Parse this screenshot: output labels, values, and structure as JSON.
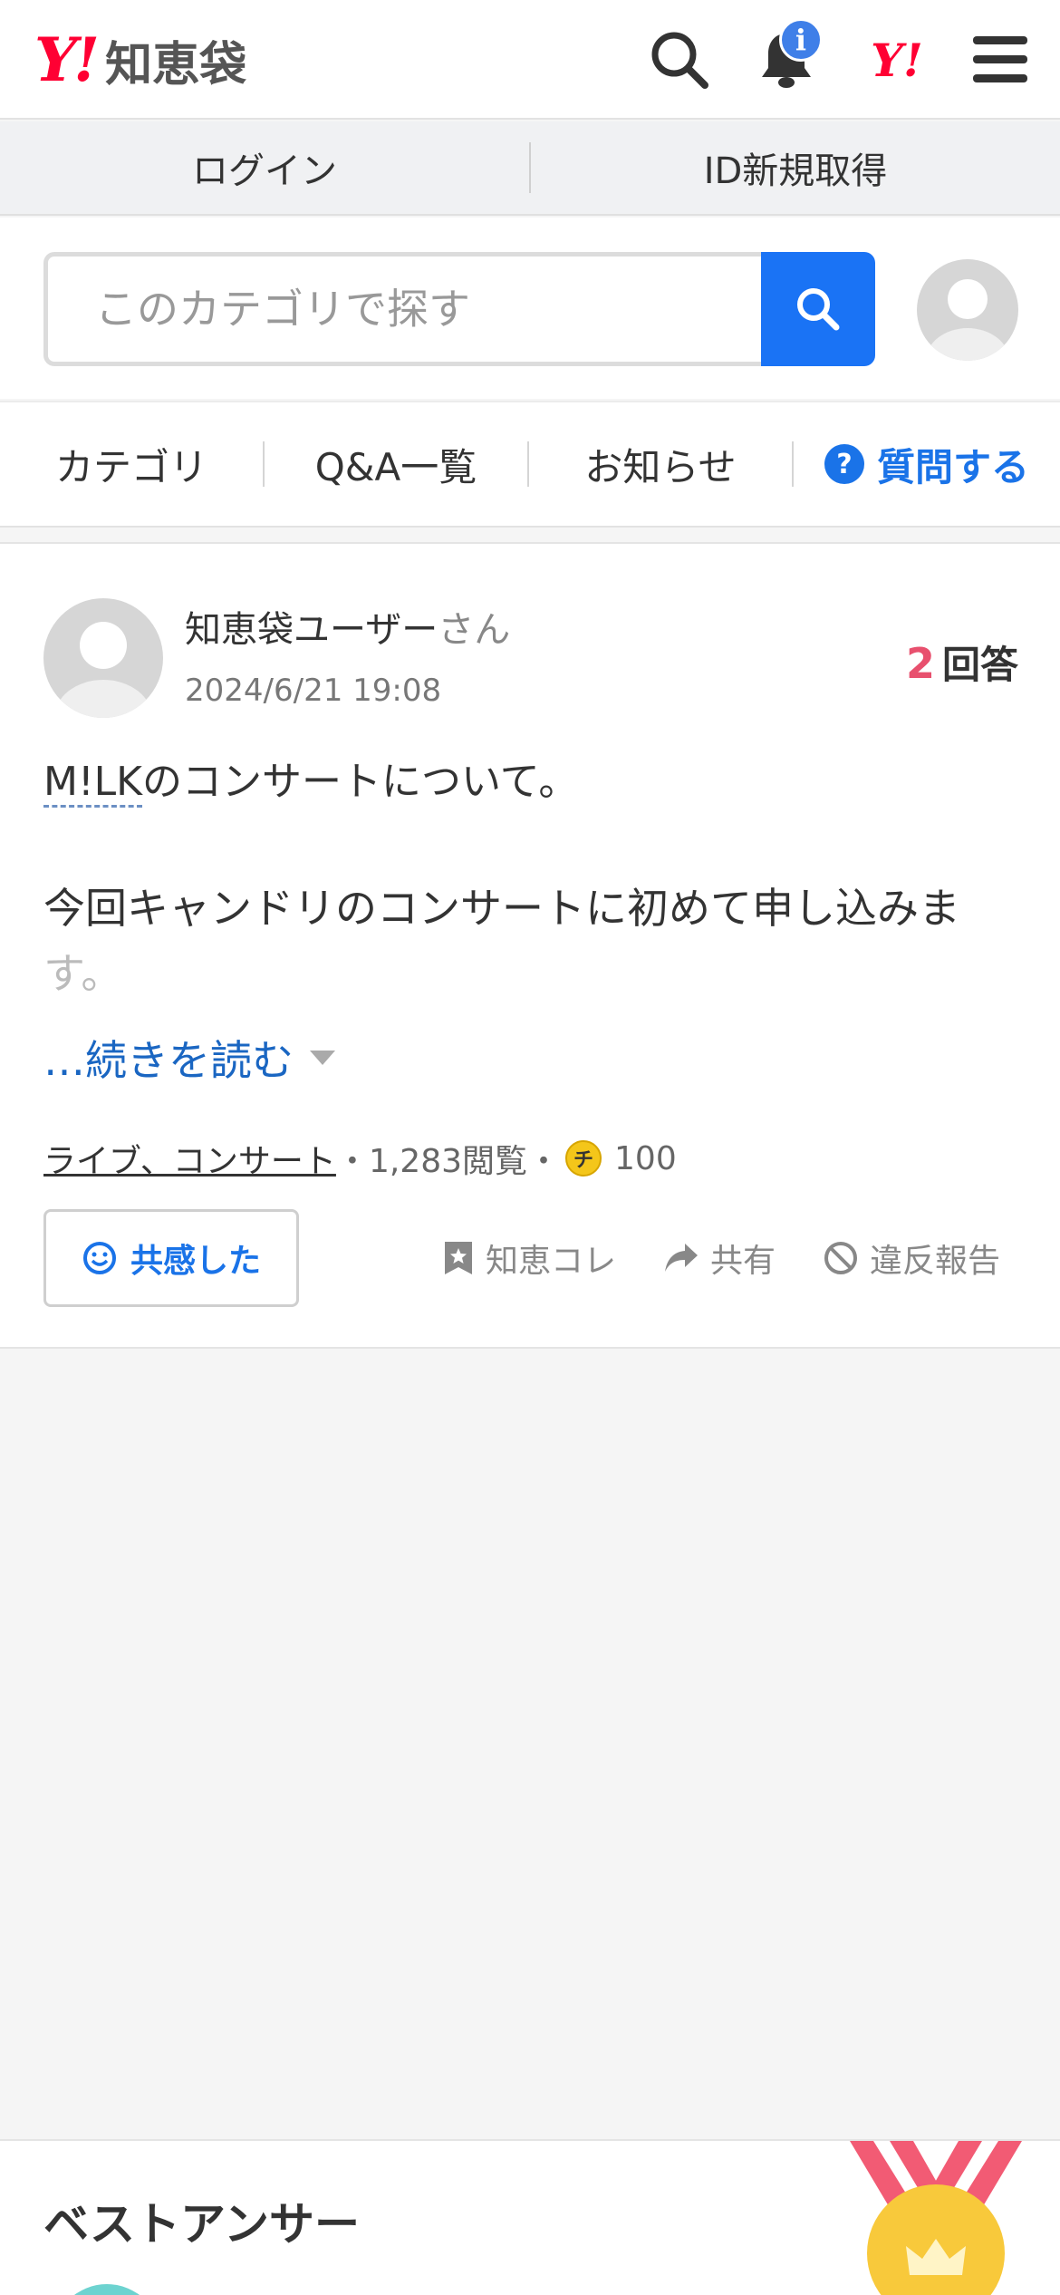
{
  "header": {
    "logo_y": "Y!",
    "logo_text": "知恵袋",
    "notification_badge": "i",
    "yahoo_mark": "Y!"
  },
  "login_bar": {
    "login_label": "ログイン",
    "register_label": "ID新規取得"
  },
  "search": {
    "placeholder": "このカテゴリで探す"
  },
  "nav": {
    "category": "カテゴリ",
    "qa_list": "Q&A一覧",
    "news": "お知らせ",
    "ask": "質問する",
    "ask_icon": "?"
  },
  "question": {
    "user_name": "知恵袋ユーザー",
    "user_suffix": "さん",
    "date": "2024/6/21 19:08",
    "answer_count": "2",
    "answer_label": "回答",
    "title_keyword": "M!LK",
    "title_rest": "のコンサートについて。",
    "body_line": "今回キャンドリのコンサートに初めて申し込みま",
    "body_fade": "す。",
    "read_more": "…続きを読む",
    "category_link": "ライブ、コンサート",
    "sep": "・",
    "views": "1,283閲覧",
    "coin_label": "チ",
    "coin_value": "100",
    "empathy_label": "共感した",
    "collect_label": "知恵コレ",
    "share_label": "共有",
    "report_label": "違反報告"
  },
  "best_answer": {
    "title": "ベストアンサー"
  },
  "colors": {
    "brand_red": "#ff0033",
    "link_blue": "#1a73e8",
    "accent_pink": "#e8506e",
    "coin_gold": "#f4c61a",
    "medal_ribbon": "#f25b74",
    "medal_gold": "#f8c93b"
  },
  "icons": [
    "search-icon",
    "bell-icon",
    "menu-icon",
    "user-avatar-icon",
    "question-icon",
    "smile-icon",
    "bookmark-star-icon",
    "share-arrow-icon",
    "prohibited-icon",
    "medal-crown-icon",
    "chevron-down-icon"
  ]
}
